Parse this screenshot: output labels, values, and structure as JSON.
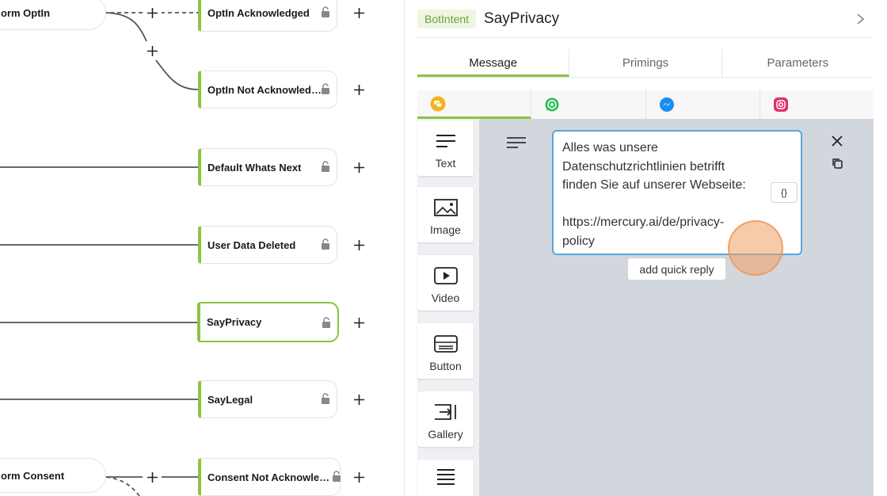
{
  "canvas": {
    "nodes": [
      {
        "label": "OptIn Acknowledged"
      },
      {
        "label": "OptIn Not Acknowledged"
      },
      {
        "label": "Default Whats Next"
      },
      {
        "label": "User Data Deleted"
      },
      {
        "label": "SayPrivacy"
      },
      {
        "label": "SayLegal"
      },
      {
        "label": "Consent Not Acknowledg..."
      }
    ],
    "pills": [
      {
        "label": "orm OptIn"
      },
      {
        "label": "orm Consent"
      }
    ]
  },
  "panel": {
    "badge": "BotIntent",
    "title": "SayPrivacy",
    "tabs": [
      "Message",
      "Primings",
      "Parameters"
    ],
    "channels": [
      "chat-icon",
      "whatsapp-icon",
      "messenger-icon",
      "instagram-icon"
    ],
    "tools": [
      "Text",
      "Image",
      "Video",
      "Button",
      "Gallery"
    ],
    "message_text": "Alles was unsere\nDatenschutzrichtlinien betrifft\nfinden Sie auf unserer Webseite:\n\nhttps://mercury.ai/de/privacy-\npolicy",
    "var_button": "{}",
    "quick_reply": "add quick reply",
    "colors": {
      "accent": "#8cc43f",
      "focus": "#5aa6de",
      "editor_bg": "#d2d6dd"
    }
  }
}
